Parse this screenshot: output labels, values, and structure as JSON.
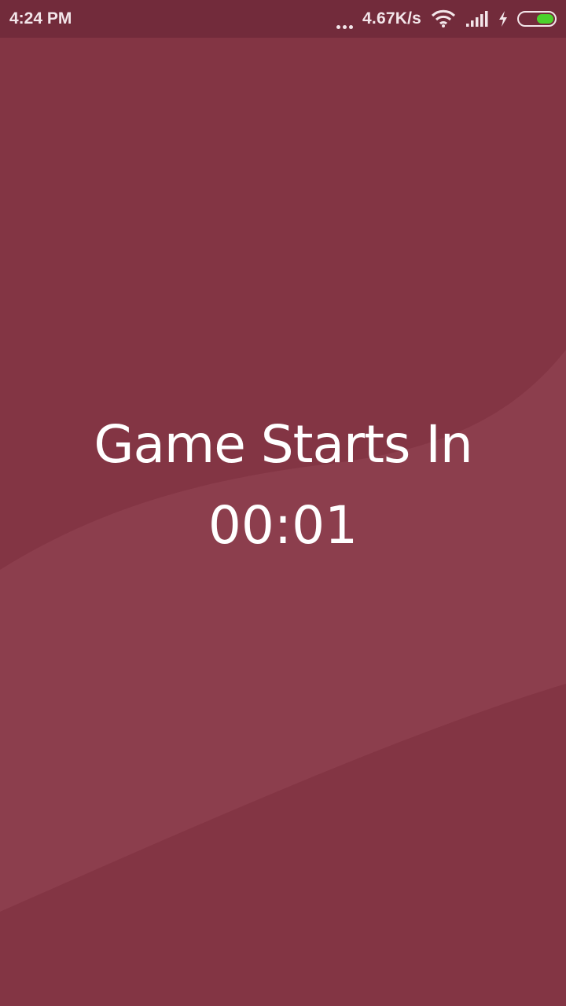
{
  "status_bar": {
    "time": "4:24 PM",
    "network_speed": "4.67K/s",
    "icons": [
      "more-dots-icon",
      "wifi-icon",
      "signal-icon",
      "charging-icon",
      "battery-icon"
    ],
    "battery_level": 0.5,
    "battery_color": "#4cd22c"
  },
  "countdown": {
    "title": "Game Starts In",
    "timer": "00:01"
  },
  "colors": {
    "background": "#833544",
    "status_bar": "#722b3b",
    "text": "#ffffff"
  }
}
